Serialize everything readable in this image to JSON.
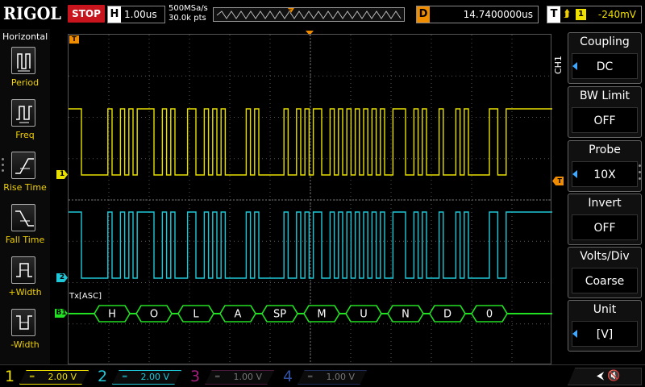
{
  "topbar": {
    "logo": "RIGOL",
    "run_state": "STOP",
    "h_key": "H",
    "timebase": "1.00us",
    "sample_rate": "500MSa/s",
    "points": "30.0k pts",
    "delay_key": "D",
    "delay_value": "14.7400000us",
    "trigger_key": "T",
    "trigger_source": "1",
    "trigger_level": "-240mV",
    "trigger_edge_icon": "rising-edge-icon"
  },
  "left_panel": {
    "title": "Horizontal",
    "items": [
      {
        "label": "Period",
        "icon": "period-icon"
      },
      {
        "label": "Freq",
        "icon": "frequency-icon"
      },
      {
        "label": "Rise Time",
        "icon": "rise-time-icon"
      },
      {
        "label": "Fall Time",
        "icon": "fall-time-icon"
      },
      {
        "label": "+Width",
        "icon": "positive-width-icon"
      },
      {
        "label": "-Width",
        "icon": "negative-width-icon"
      }
    ]
  },
  "waveform": {
    "trigger_position_marker": "T",
    "ch1_marker": "1",
    "ch2_marker": "2",
    "bus_marker": "B1",
    "decode_label": "Tx[ASC]",
    "decoded_bytes": [
      "H",
      "O",
      "L",
      "A",
      "SP",
      "M",
      "U",
      "N",
      "D",
      "0"
    ],
    "colors": {
      "ch1": "#e8e000",
      "ch2": "#1fc8d8",
      "bus": "#22e022",
      "trigger": "#f08c00",
      "grid": "#555555"
    }
  },
  "right_panel": {
    "channel_tag": "CH1",
    "items": [
      {
        "title": "Coupling",
        "value": "DC",
        "arrow": true
      },
      {
        "title": "BW Limit",
        "value": "OFF",
        "arrow": false
      },
      {
        "title": "Probe",
        "value": "10X",
        "arrow": true
      },
      {
        "title": "Invert",
        "value": "OFF",
        "arrow": false
      },
      {
        "title": "Volts/Div",
        "value": "Coarse",
        "arrow": false
      },
      {
        "title": "Unit",
        "value": "[V]",
        "arrow": true
      }
    ]
  },
  "bottombar": {
    "channels": [
      {
        "num": "1",
        "coupling": "DC",
        "scale": "2.00 V",
        "color": "#f0e000",
        "active": true
      },
      {
        "num": "2",
        "coupling": "DC",
        "scale": "2.00 V",
        "color": "#1fc8d8",
        "active": true
      },
      {
        "num": "3",
        "coupling": "DC",
        "scale": "1.00 V",
        "color": "#a0207a",
        "active": false
      },
      {
        "num": "4",
        "coupling": "DC",
        "scale": "1.00 V",
        "color": "#3050a0",
        "active": false
      }
    ],
    "icons": [
      "usb-icon",
      "speaker-mute-icon"
    ]
  }
}
